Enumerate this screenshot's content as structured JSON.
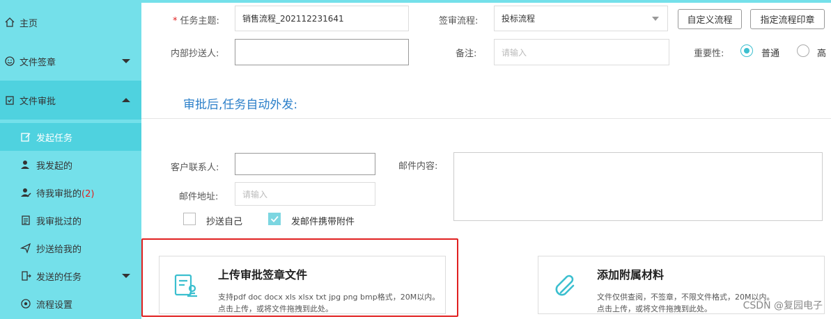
{
  "sidebar": {
    "home": "主页",
    "file_sign": "文件签章",
    "file_approve": "文件审批",
    "subs": {
      "initiate": "发起任务",
      "mine": "我发起的",
      "pending": "待我审批的",
      "pending_count": "(2)",
      "approved": "我审批过的",
      "cc_me": "抄送给我的",
      "sent": "发送的任务",
      "process": "流程设置"
    }
  },
  "form": {
    "subject_label": "任务主题:",
    "subject_value": "销售流程_202112231641",
    "flow_label": "签审流程:",
    "flow_value": "投标流程",
    "custom_flow_btn": "自定义流程",
    "assign_seal_btn": "指定流程印章",
    "cc_label": "内部抄送人:",
    "remark_label": "备注:",
    "remark_placeholder": "请输入",
    "importance_label": "重要性:",
    "importance_normal": "普通",
    "importance_high": "高"
  },
  "auto_send": {
    "title": "审批后,任务自动外发:",
    "contact_label": "客户联系人:",
    "email_content_label": "邮件内容:",
    "email_addr_label": "邮件地址:",
    "email_addr_placeholder": "请输入",
    "cc_self": "抄送自己",
    "attach": "发邮件携带附件"
  },
  "upload": {
    "title": "上传审批签章文件",
    "desc1": "支持pdf doc docx xls xlsx txt jpg png bmp格式，20M以内。",
    "desc2": "点击上传，或将文件拖拽到此处。"
  },
  "attach_card": {
    "title": "添加附属材料",
    "desc1": "文件仅供查阅，不签章，不限文件格式，20M以内。",
    "desc2": "点击上传，或将文件拖拽到此处。"
  },
  "watermark": "CSDN @复园电子",
  "colors": {
    "sidebar": "#74e0ea",
    "sidebar_selected": "#4fd2df",
    "accent": "#3bbfcf",
    "section_title": "#2b7fc9",
    "highlight": "#e02020"
  }
}
